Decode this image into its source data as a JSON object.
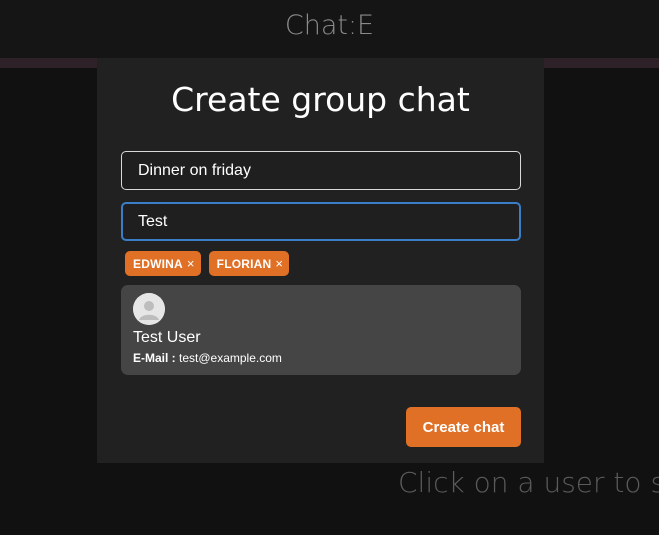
{
  "app": {
    "title": "Chat:E",
    "background_hint": "Click on a user to s"
  },
  "modal": {
    "title": "Create group chat",
    "chat_name_value": "Dinner on friday",
    "user_search_value": "Test",
    "selected_users": [
      {
        "label": "EDWINA",
        "remove_glyph": "×"
      },
      {
        "label": "FLORIAN",
        "remove_glyph": "×"
      }
    ],
    "search_results": [
      {
        "name": "Test User",
        "email_label": "E-Mail :",
        "email": "test@example.com",
        "avatar_icon": "user-avatar-icon"
      }
    ],
    "create_button_label": "Create chat"
  },
  "colors": {
    "accent": "#e07025",
    "focus_border": "#3a7ec7",
    "modal_bg": "#212121",
    "card_bg": "#454545"
  }
}
